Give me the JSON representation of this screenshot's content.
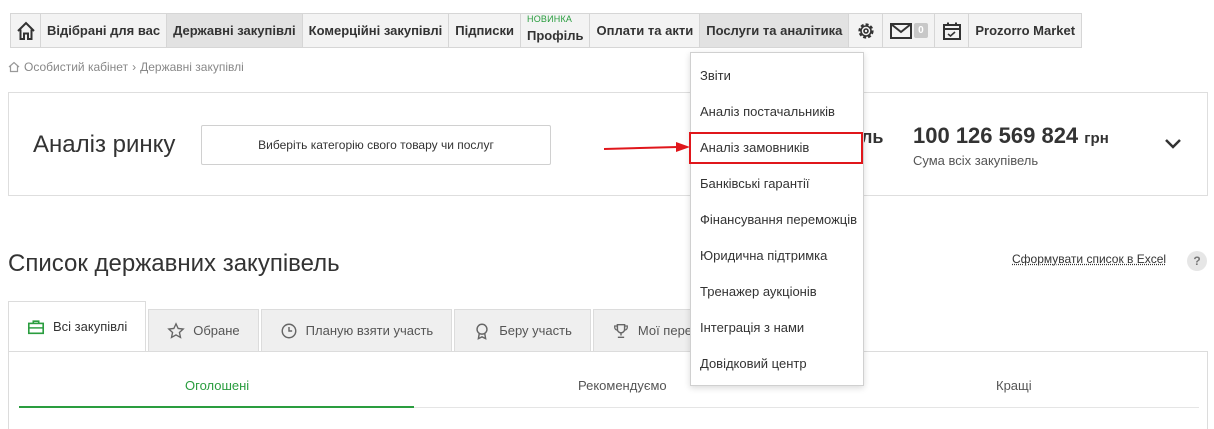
{
  "nav": {
    "items": [
      {
        "label": "Відібрані для вас"
      },
      {
        "label": "Державні закупівлі"
      },
      {
        "label": "Комерційні закупівлі"
      },
      {
        "label": "Підписки"
      },
      {
        "label": "Профіль",
        "badge": "НОВИНКА"
      },
      {
        "label": "Оплати та акти"
      },
      {
        "label": "Послуги та аналітика"
      },
      {
        "label": "Prozorro Market"
      }
    ],
    "mail_count": "0"
  },
  "breadcrumb": {
    "home": "Особистий кабінет",
    "separator": "›",
    "current": "Державні закупівлі"
  },
  "market": {
    "title": "Аналіз ринку",
    "category_button": "Виберіть категорію свого товару чи послуг",
    "partial_text": "ль",
    "total_amount": "100 126 569 824",
    "currency": "грн",
    "total_label": "Сума всіх закупівель"
  },
  "list": {
    "title": "Список державних закупівель",
    "excel_link": "Сформувати список в Excel",
    "help": "?"
  },
  "tabs": [
    {
      "label": "Всі закупівлі"
    },
    {
      "label": "Обране"
    },
    {
      "label": "Планую взяти участь"
    },
    {
      "label": "Беру участь"
    },
    {
      "label": "Мої пере"
    }
  ],
  "subtabs": [
    {
      "label": "Оголошені"
    },
    {
      "label": "Рекомендуємо"
    },
    {
      "label": "Кращі"
    }
  ],
  "dropdown": {
    "items": [
      {
        "label": "Звіти"
      },
      {
        "label": "Аналіз постачальників"
      },
      {
        "label": "Аналіз замовників"
      },
      {
        "label": "Банківські гарантії"
      },
      {
        "label": "Фінансування переможців"
      },
      {
        "label": "Юридична підтримка"
      },
      {
        "label": "Тренажер аукціонів"
      },
      {
        "label": "Інтеграція з нами"
      },
      {
        "label": "Довідковий центр"
      }
    ]
  },
  "colors": {
    "accent_green": "#2a9d3f",
    "highlight_red": "#e0161b"
  }
}
